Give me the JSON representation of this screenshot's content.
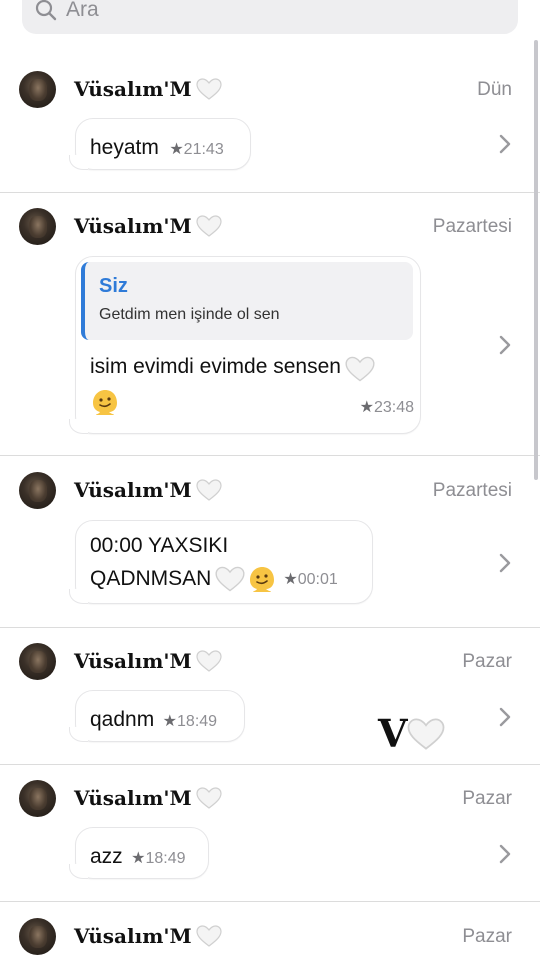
{
  "search": {
    "placeholder": "Ara"
  },
  "colors": {
    "accent": "#2f7bd8",
    "secondary_text": "#8e8e93"
  },
  "results": [
    {
      "name": "Vüsalım'M",
      "date": "Dün",
      "text": "heyatm",
      "time": "21:43"
    },
    {
      "name": "Vüsalım'M",
      "date": "Pazartesi",
      "reply": {
        "author": "Siz",
        "text": "Getdim men işinde ol sen"
      },
      "text_line1": "isim evimdi evimde sensen",
      "time": "23:48"
    },
    {
      "name": "Vüsalım'M",
      "date": "Pazartesi",
      "text_line1": "00:00 YAXSIKI",
      "text_line2": "QADNMSAN",
      "time": "00:01"
    },
    {
      "name": "Vüsalım'M",
      "date": "Pazar",
      "text": "qadnm",
      "time": "18:49"
    },
    {
      "name": "Vüsalım'M",
      "date": "Pazar",
      "text": "azz",
      "time": "18:49"
    },
    {
      "name": "Vüsalım'M",
      "date": "Pazar"
    }
  ],
  "watermark": {
    "letter": "V"
  },
  "icons": {
    "heart": "white-heart-icon",
    "emoji": "melting-face-icon",
    "chevron": "chevron-right-icon",
    "search": "search-icon"
  }
}
